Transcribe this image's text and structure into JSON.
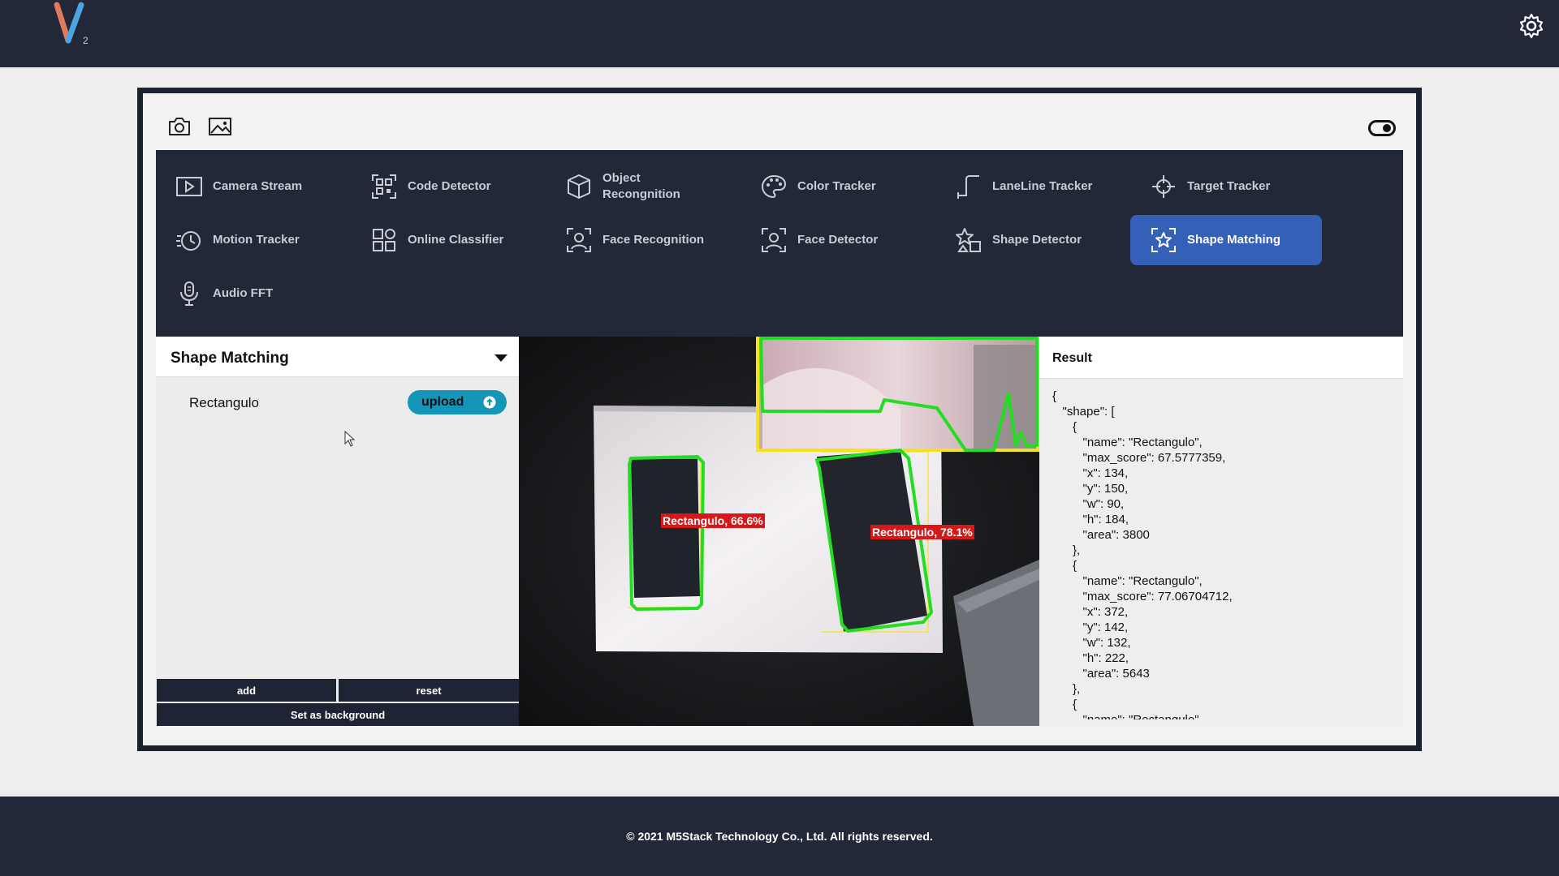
{
  "app": {
    "logo_letter": "V",
    "logo_sub": "2"
  },
  "menu": {
    "items": [
      {
        "label": "Camera Stream",
        "icon": "play-icon"
      },
      {
        "label": "Code Detector",
        "icon": "qr-code-icon"
      },
      {
        "label": "Object Recongnition",
        "icon": "cube-icon"
      },
      {
        "label": "Color Tracker",
        "icon": "palette-icon"
      },
      {
        "label": "LaneLine Tracker",
        "icon": "lane-line-icon"
      },
      {
        "label": "Target Tracker",
        "icon": "crosshair-icon"
      },
      {
        "label": "Motion Tracker",
        "icon": "motion-icon"
      },
      {
        "label": "Online Classifier",
        "icon": "grid-icon"
      },
      {
        "label": "Face Recognition",
        "icon": "face-scan-icon"
      },
      {
        "label": "Face Detector",
        "icon": "face-detect-icon"
      },
      {
        "label": "Shape Detector",
        "icon": "shapes-icon"
      },
      {
        "label": "Shape Matching",
        "icon": "shape-match-icon",
        "active": true
      },
      {
        "label": "Audio FFT",
        "icon": "microphone-icon"
      }
    ]
  },
  "left": {
    "title": "Shape Matching",
    "shape_name": "Rectangulo",
    "upload_label": "upload",
    "add_label": "add",
    "reset_label": "reset",
    "background_label": "Set as background"
  },
  "camera": {
    "detections": [
      {
        "label": "Rectangulo, 66.6%"
      },
      {
        "label": "Rectangulo, 78.1%"
      }
    ]
  },
  "result": {
    "title": "Result",
    "json_text": "{\n   \"shape\": [\n      {\n         \"name\": \"Rectangulo\",\n         \"max_score\": 67.5777359,\n         \"x\": 134,\n         \"y\": 150,\n         \"w\": 90,\n         \"h\": 184,\n         \"area\": 3800\n      },\n      {\n         \"name\": \"Rectangulo\",\n         \"max_score\": 77.06704712,\n         \"x\": 372,\n         \"y\": 142,\n         \"w\": 132,\n         \"h\": 222,\n         \"area\": 5643\n      },\n      {\n         \"name\": \"Rectangulo\","
  },
  "footer": {
    "text": "© 2021 M5Stack Technology Co., Ltd. All rights reserved."
  },
  "colors": {
    "dark_bg": "#222838",
    "active_item": "#3560b8",
    "upload_btn": "#1596b8",
    "detection_label": "#d81818",
    "contour_green": "#22dd22",
    "bbox_yellow": "#f2e31a"
  }
}
